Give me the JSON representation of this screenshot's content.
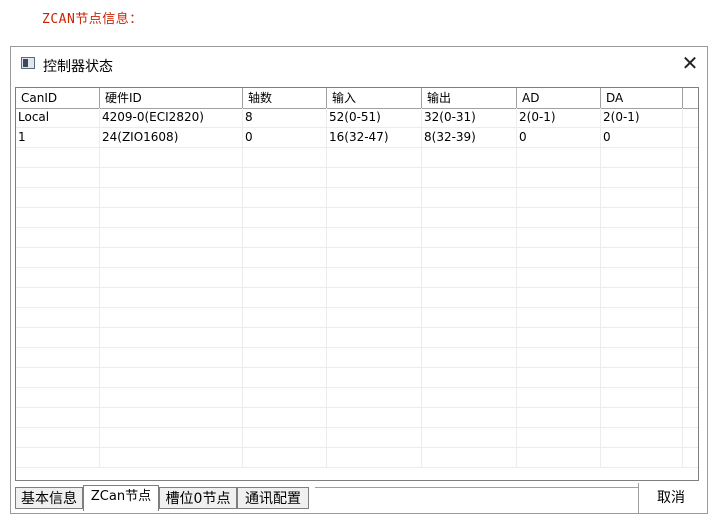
{
  "caption": "ZCAN节点信息：",
  "dialog": {
    "title": "控制器状态",
    "close_glyph": "✕"
  },
  "table": {
    "columns": [
      "CanID",
      "硬件ID",
      "轴数",
      "输入",
      "输出",
      "AD",
      "DA"
    ],
    "rows": [
      [
        "Local",
        "4209-0(ECI2820)",
        "8",
        "52(0-51)",
        "32(0-31)",
        "2(0-1)",
        "2(0-1)"
      ],
      [
        "1",
        "24(ZIO1608)",
        "0",
        "16(32-47)",
        "8(32-39)",
        "0",
        "0"
      ]
    ]
  },
  "tabs": [
    "基本信息",
    "ZCan节点",
    "槽位0节点",
    "通讯配置"
  ],
  "active_tab": "ZCan节点",
  "cancel_label": "取消",
  "colors": {
    "caption": "#cc2200",
    "border": "#7f7f7f"
  },
  "icons": {
    "title": "window-icon",
    "close": "close-icon"
  }
}
